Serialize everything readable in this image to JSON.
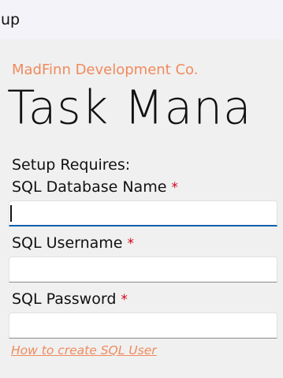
{
  "window": {
    "title": "up"
  },
  "header": {
    "company": "MadFinn Development Co.",
    "app_title": "Task Mana"
  },
  "form": {
    "intro": "Setup Requires:",
    "required_marker": "*",
    "fields": [
      {
        "label": "SQL Database Name",
        "value": "",
        "placeholder": ""
      },
      {
        "label": "SQL Username",
        "value": "",
        "placeholder": ""
      },
      {
        "label": "SQL Password",
        "value": "",
        "placeholder": ""
      }
    ],
    "help_link": "How to create SQL User"
  },
  "colors": {
    "accent": "#f08a5d",
    "required": "#d0021b",
    "focus": "#0a5fab"
  }
}
